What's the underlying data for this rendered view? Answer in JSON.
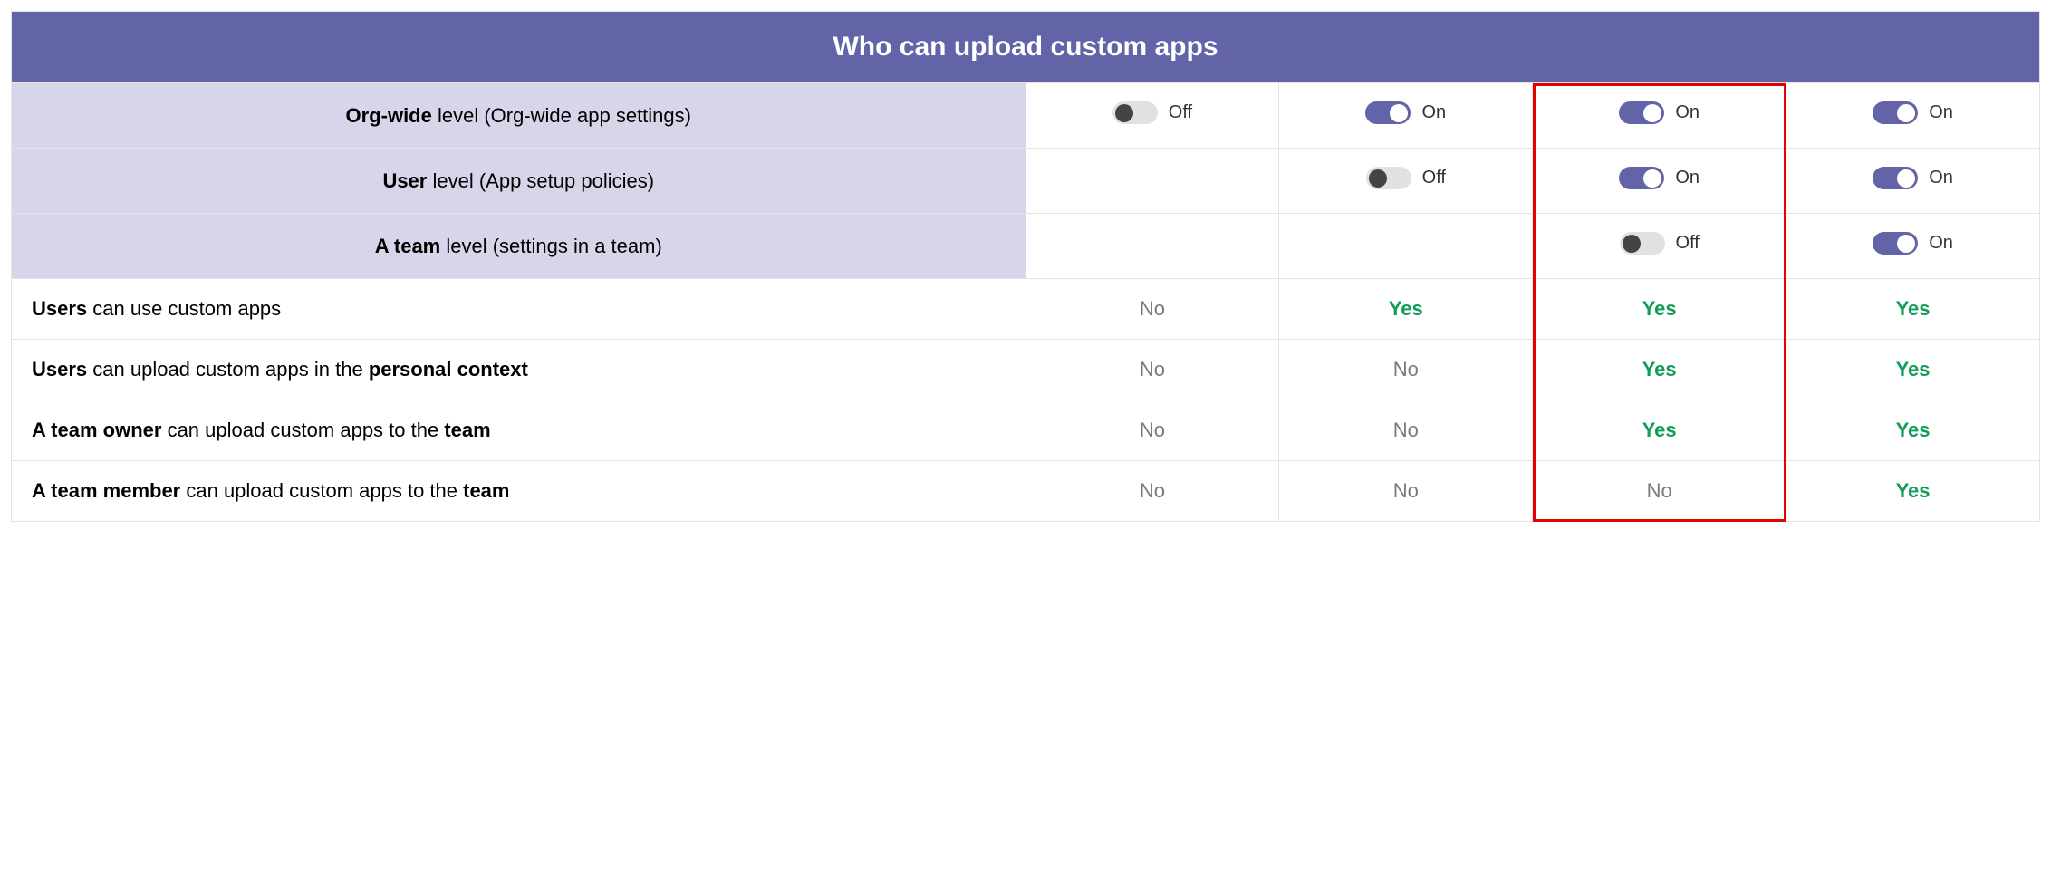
{
  "title": "Who can upload custom apps",
  "labels": {
    "on": "On",
    "off": "Off",
    "yes": "Yes",
    "no": "No"
  },
  "level_rows": [
    {
      "bold": "Org-wide",
      "rest": " level (Org-wide app settings)",
      "cells": [
        "off",
        "on",
        "on",
        "on"
      ]
    },
    {
      "bold": "User",
      "rest": " level (App setup policies)",
      "cells": [
        "",
        "off",
        "on",
        "on"
      ]
    },
    {
      "bold": "A team",
      "rest": " level (settings in a team)",
      "cells": [
        "",
        "",
        "off",
        "on"
      ]
    }
  ],
  "outcome_rows": [
    {
      "b1": "Users",
      "t1": " can use custom apps",
      "b2": "",
      "t2": "",
      "cells": [
        "no",
        "yes",
        "yes",
        "yes"
      ]
    },
    {
      "b1": "Users",
      "t1": " can upload custom apps in the ",
      "b2": "personal context",
      "t2": "",
      "cells": [
        "no",
        "no",
        "yes",
        "yes"
      ]
    },
    {
      "b1": "A team owner",
      "t1": " can upload custom apps to the ",
      "b2": "team",
      "t2": "",
      "cells": [
        "no",
        "no",
        "yes",
        "yes"
      ]
    },
    {
      "b1": "A team member",
      "t1": " can upload custom apps to the ",
      "b2": "team",
      "t2": "",
      "cells": [
        "no",
        "no",
        "no",
        "yes"
      ]
    }
  ],
  "highlight_column_index": 2
}
